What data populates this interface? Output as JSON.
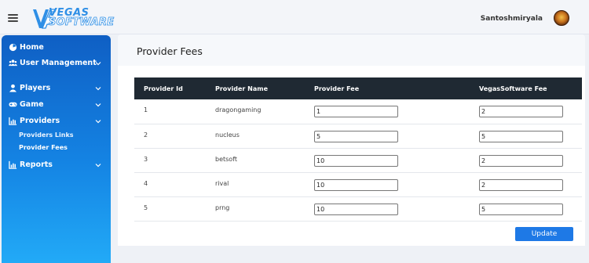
{
  "header": {
    "logo_line1": "VEGAS",
    "logo_line2": "SOFTWARE",
    "username": "Santoshmiryala",
    "menu_icon": "hamburger-menu-icon",
    "avatar_icon": "user-avatar"
  },
  "sidebar": {
    "items": [
      {
        "label": "Home",
        "icon": "home-icon",
        "has_chevron": false
      },
      {
        "label": "User Management",
        "icon": "users-icon",
        "has_chevron": true
      },
      {
        "label": "Players",
        "icon": "user-icon",
        "has_chevron": true
      },
      {
        "label": "Game",
        "icon": "gamepad-icon",
        "has_chevron": true
      },
      {
        "label": "Providers",
        "icon": "chart-icon",
        "has_chevron": true
      },
      {
        "label": "Reports",
        "icon": "chart-icon",
        "has_chevron": true
      }
    ],
    "providers_sub": [
      {
        "label": "Providers Links"
      },
      {
        "label": "Provider Fees"
      }
    ]
  },
  "main": {
    "title": "Provider Fees",
    "table": {
      "headers": [
        "Provider Id",
        "Provider Name",
        "Provider Fee",
        "VegasSoftware Fee"
      ],
      "rows": [
        {
          "id": "1",
          "name": "dragongaming",
          "provider_fee": "1",
          "vegas_fee": "2"
        },
        {
          "id": "2",
          "name": "nucleus",
          "provider_fee": "5",
          "vegas_fee": "5"
        },
        {
          "id": "3",
          "name": "betsoft",
          "provider_fee": "10",
          "vegas_fee": "2"
        },
        {
          "id": "4",
          "name": "rival",
          "provider_fee": "10",
          "vegas_fee": "2"
        },
        {
          "id": "5",
          "name": "prng",
          "provider_fee": "10",
          "vegas_fee": "5"
        }
      ]
    },
    "update_label": "Update"
  },
  "colors": {
    "sidebar_top": "#0f5fc4",
    "sidebar_bottom": "#22aaf7",
    "table_header": "#1f2933",
    "button": "#1e79e6"
  }
}
